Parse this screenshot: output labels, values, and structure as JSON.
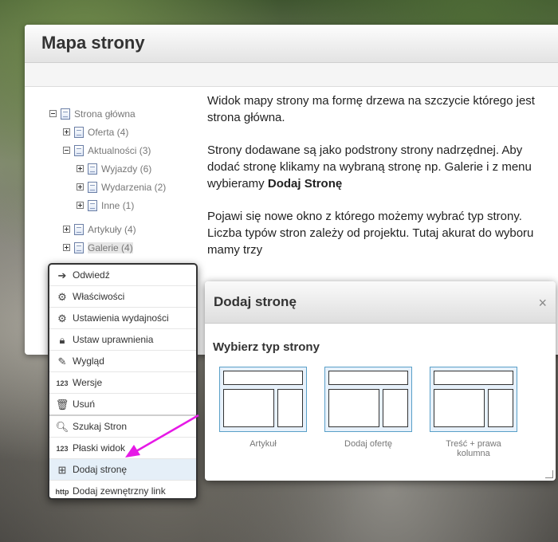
{
  "page": {
    "title": "Mapa strony"
  },
  "tree": {
    "nodes": [
      {
        "label": "Strona główna"
      },
      {
        "label": "Oferta (4)"
      },
      {
        "label": "Aktualności (3)"
      },
      {
        "label": "Wyjazdy (6)"
      },
      {
        "label": "Wydarzenia (2)"
      },
      {
        "label": "Inne (1)"
      },
      {
        "label": "Artykuły (4)"
      },
      {
        "label": "Galerie (4)"
      }
    ]
  },
  "description": {
    "p1": "Widok mapy strony ma formę drzewa na szczycie którego jest strona główna.",
    "p2_text": "Strony dodawane są jako podstrony strony nadrzędnej. Aby dodać stronę klikamy na wybraną stronę np. Galerie i z menu wybieramy ",
    "p2_bold": "Dodaj Stronę",
    "p3": "Pojawi się nowe okno z którego możemy wybrać typ strony. Liczba typów stron zależy od projektu. Tutaj akurat do wyboru mamy trzy"
  },
  "context_menu": {
    "items": [
      {
        "label": "Odwiedź",
        "icon": "arrow-right-icon"
      },
      {
        "label": "Właściwości",
        "icon": "gears-icon"
      },
      {
        "label": "Ustawienia wydajności",
        "icon": "gear-speed-icon"
      },
      {
        "label": "Ustaw uprawnienia",
        "icon": "lock-icon"
      },
      {
        "label": "Wygląd",
        "icon": "paint-icon"
      },
      {
        "label": "Wersje",
        "icon": "numbers-icon",
        "glyph": "123"
      },
      {
        "label": "Usuń",
        "icon": "trash-icon"
      },
      {
        "label": "Szukaj Stron",
        "icon": "search-page-icon"
      },
      {
        "label": "Płaski widok",
        "icon": "flat-view-icon",
        "glyph": "123"
      },
      {
        "label": "Dodaj stronę",
        "icon": "add-page-icon"
      },
      {
        "label": "Dodaj zewnętrzny link",
        "icon": "http-link-icon",
        "glyph": "http"
      }
    ]
  },
  "dialog": {
    "title": "Dodaj stronę",
    "close": "×",
    "subtitle": "Wybierz typ strony",
    "templates": [
      {
        "label": "Artykuł"
      },
      {
        "label": "Dodaj ofertę"
      },
      {
        "label": "Treść + prawa kolumna"
      }
    ]
  },
  "colors": {
    "arrow": "#e619e6",
    "menu_active": "#e5eff8",
    "template_border": "#5aa0c8"
  }
}
